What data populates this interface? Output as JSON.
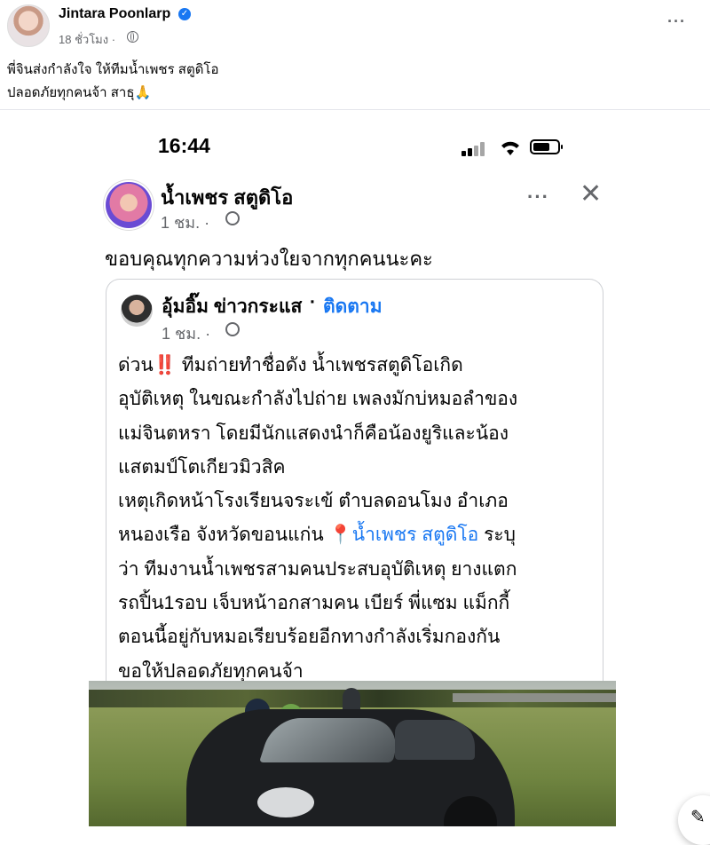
{
  "post": {
    "author": "Jintara Poonlarp",
    "time": "18 ชั่วโมง ·",
    "text_lines": [
      "พี่จินส่งกำลังใจ ให้ทีมน้ำเพชร สตูดิโอ",
      "ปลอดภัยทุกคนจ้า สาธุ🙏"
    ],
    "more": "···"
  },
  "screenshot": {
    "status_time": "16:44",
    "page": {
      "name": "น้ำเพชร สตูดิโอ",
      "time": "1 ชม. ·",
      "more": "···",
      "close": "✕",
      "text": "ขอบคุณทุกความห่วงใยจากทุกคนนะคะ"
    },
    "shared": {
      "name": "อุ้มอิ๊ม ข่าวกระแส",
      "dot": "·",
      "follow": "ติดตาม",
      "time": "1 ชม. ·",
      "lines": [
        {
          "pre": "ด่วน",
          "bang": "‼️",
          "post": " ทีมถ่ายทำชื่อดัง น้ำเพชรสตูดิโอเกิด"
        },
        "อุบัติเหตุ ในขณะกำลังไปถ่าย เพลงมักบ่หมอลำของ",
        "แม่จินตหรา โดยมีนักแสดงนำก็คือน้องยูริและน้อง",
        "แสตมป์โตเกียวมิวสิค",
        "เหตุเกิดหน้าโรงเรียนจระเข้ ตำบลดอนโมง อำเภอ",
        {
          "pre": "หนองเรือ จังหวัดขอนแก่น ",
          "pin": "📍",
          "mention": "น้ำเพชร สตูดิโอ",
          "post": " ระบุ"
        },
        "ว่า ทีมงานน้ำเพชรสามคนประสบอุบัติเหตุ ยางแตก",
        "รถปิ้น1รอบ เจ็บหน้าอกสามคน เบียร์ พี่แซม แม็กกี้",
        "ตอนนี้อยู่กับหมอเรียบร้อยอีกทางกำลังเริ่มกองกัน",
        "ขอให้ปลอดภัยทุกคนจ้า"
      ]
    }
  },
  "colors": {
    "link": "#1877f2",
    "secondary_text": "#65676b",
    "verified": "#1877f2"
  }
}
